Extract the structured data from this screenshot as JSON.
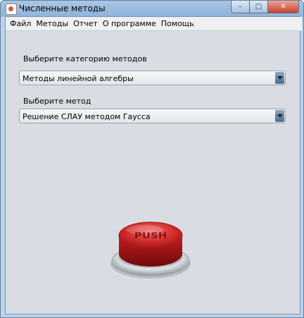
{
  "window": {
    "title": "Численные методы",
    "controls": {
      "minimize": "–",
      "maximize": "□",
      "close": "✕"
    }
  },
  "menu": [
    "Файл",
    "Методы",
    "Отчет",
    "О программе",
    "Помощь"
  ],
  "category": {
    "label": "Выберите категорию методов",
    "selected": "Методы линейной алгебры"
  },
  "method": {
    "label": "Выберите метод",
    "selected": "Решение СЛАУ методом Гаусса"
  },
  "push_button": {
    "label": "PUSH",
    "color": "#c81e1e"
  },
  "icons": {
    "app": "java-icon",
    "dropdown": "chevron-down-icon"
  }
}
